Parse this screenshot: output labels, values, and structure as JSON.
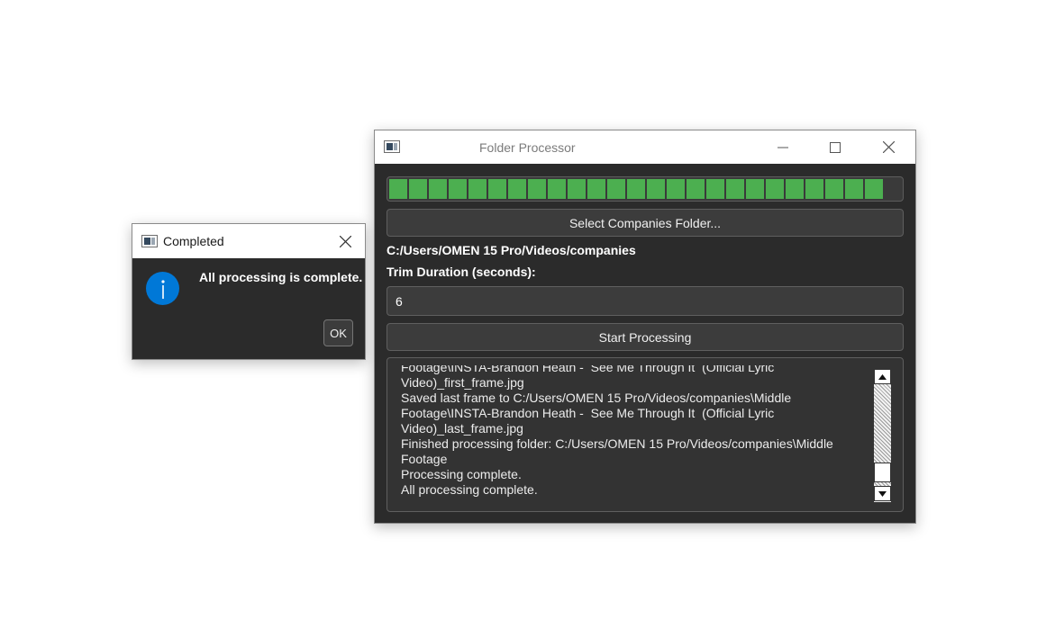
{
  "main_window": {
    "title": "Folder Processor",
    "icon": "app-window-icon",
    "controls": {
      "minimize_icon": "minimize-icon",
      "maximize_icon": "maximize-icon",
      "close_icon": "close-icon"
    },
    "progress": {
      "value_percent": 100,
      "color": "#4caf50"
    },
    "select_folder_label": "Select Companies Folder...",
    "folder_path": "C:/Users/OMEN 15 Pro/Videos/companies",
    "trim_duration_label": "Trim Duration (seconds):",
    "trim_duration_value": "6",
    "start_processing_label": "Start Processing",
    "log_lines": [
      "Footage\\INSTA-Brandon Heath -  See Me Through It  (Official Lyric",
      "Video)_first_frame.jpg",
      "Saved last frame to C:/Users/OMEN 15 Pro/Videos/companies\\Middle",
      "Footage\\INSTA-Brandon Heath -  See Me Through It  (Official Lyric",
      "Video)_last_frame.jpg",
      "Finished processing folder: C:/Users/OMEN 15 Pro/Videos/companies\\Middle",
      "Footage",
      "Processing complete.",
      "All processing complete."
    ]
  },
  "dialog": {
    "title": "Completed",
    "icon": "information-icon",
    "message": "All processing is complete.",
    "ok_label": "OK",
    "info_color": "#0078d7"
  }
}
